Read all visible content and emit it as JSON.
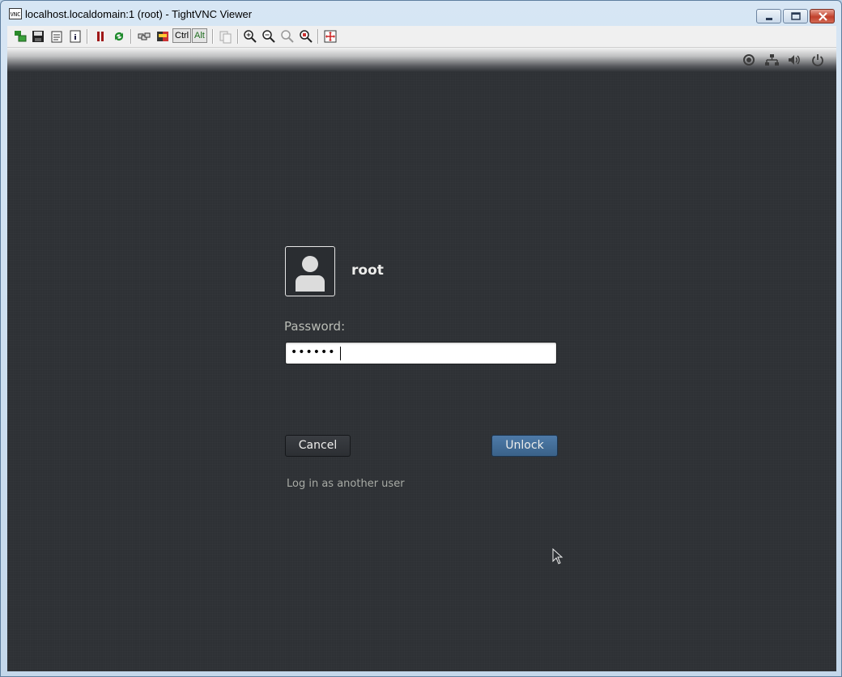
{
  "window": {
    "title": "localhost.localdomain:1 (root) - TightVNC Viewer",
    "icon_label": "VNC"
  },
  "toolbar": {
    "buttons": [
      "new-connection-icon",
      "save-icon",
      "options-icon",
      "info-icon",
      "pause-icon",
      "refresh-icon",
      "send-ctrl-alt-del-icon",
      "transfer-files-icon",
      "ctrl-key",
      "alt-key",
      "clipboard-icon",
      "zoom-in-icon",
      "zoom-out-icon",
      "zoom-100-icon",
      "zoom-fit-icon",
      "fullscreen-icon"
    ],
    "ctrl_label": "Ctrl",
    "alt_label": "Alt"
  },
  "topbar": {
    "icons": [
      "accessibility-icon",
      "network-icon",
      "volume-icon",
      "power-icon"
    ]
  },
  "login": {
    "username": "root",
    "password_label": "Password:",
    "password_value": "••••••",
    "cancel_label": "Cancel",
    "unlock_label": "Unlock",
    "other_user_label": "Log in as another user"
  },
  "colors": {
    "screen_bg": "#2e3135",
    "unlock_bg": "#3a6289",
    "text_light": "#eeeeec"
  }
}
